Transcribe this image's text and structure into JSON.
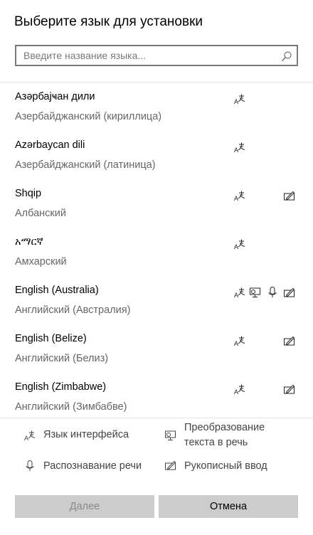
{
  "dialog": {
    "title": "Выберите язык для установки"
  },
  "search": {
    "placeholder": "Введите название языка...",
    "icon": "search-icon"
  },
  "languages": [
    {
      "native": "Азәрбајҹан дили",
      "localized": "Азербайджанский (кириллица)",
      "features": [
        "interface"
      ]
    },
    {
      "native": "Azərbaycan dili",
      "localized": "Азербайджанский (латиница)",
      "features": [
        "interface"
      ]
    },
    {
      "native": "Shqip",
      "localized": "Албанский",
      "features": [
        "interface",
        "handwriting"
      ]
    },
    {
      "native": "አማርኛ",
      "localized": "Амхарский",
      "features": [
        "interface"
      ]
    },
    {
      "native": "English (Australia)",
      "localized": "Английский (Австралия)",
      "features": [
        "interface",
        "tts",
        "speech",
        "handwriting"
      ]
    },
    {
      "native": "English (Belize)",
      "localized": "Английский (Белиз)",
      "features": [
        "interface",
        "handwriting"
      ]
    },
    {
      "native": "English (Zimbabwe)",
      "localized": "Английский (Зимбабве)",
      "features": [
        "interface",
        "handwriting"
      ]
    }
  ],
  "legend": {
    "interface": "Язык интерфейса",
    "tts": "Преобразование текста в речь",
    "speech": "Распознавание речи",
    "handwriting": "Рукописный ввод"
  },
  "buttons": {
    "next": "Далее",
    "cancel": "Отмена"
  },
  "colors": {
    "button_bg": "#cccccc",
    "disabled_text": "#8a8a8a",
    "secondary_text": "#666666",
    "border": "#7a7a7a"
  }
}
